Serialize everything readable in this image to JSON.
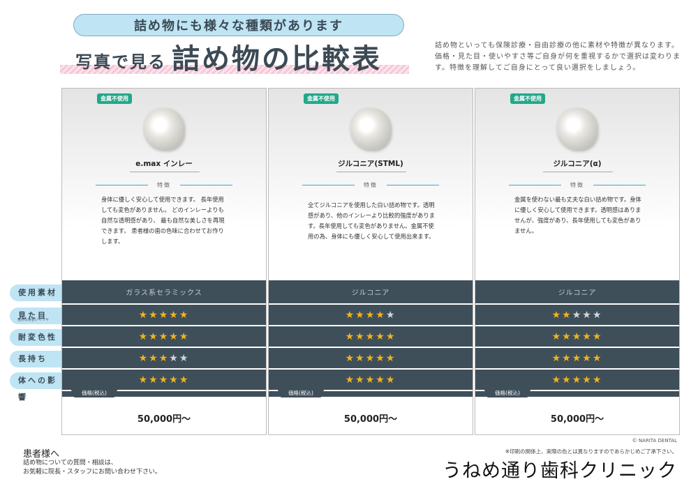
{
  "header": {
    "pill": "詰め物にも様々な種類があります",
    "title_sub": "写真で見る",
    "title_main": "詰め物の比較表",
    "intro": "詰め物といっても保険診療・自由診療の他に素材や特徴が異なります。価格・見た目・使いやすさ等ご自身が何を重視するかで選択は変わります。特徴を理解してご自身にとって良い選択をしましょう。"
  },
  "row_labels": {
    "material": "使用素材",
    "appearance": "見た目",
    "appearance_sub": "自然な色合いやツヤ",
    "discoloration": "耐変色性",
    "durability": "長持ち",
    "body_effect": "体への影響"
  },
  "feature_label": "特徴",
  "price_label": "価格(税込)",
  "colors": {
    "accent_blue": "#bfe4f4",
    "row_dark": "#3f4f5a",
    "badge_green": "#22a88a",
    "star": "#f2b41c"
  },
  "products": [
    {
      "badge": "金属不使用",
      "name": "e.max インレー",
      "desc": "身体に優しく安心して使用できます。 長年使用しても変色がありません。 どのインレーよりも自然な透明感があり、 最も自然な美しさを再現できます。 患者様の歯の色味に合わせてお作りします。",
      "material": "ガラス系セラミックス",
      "ratings": {
        "appearance": 5,
        "discoloration": 5,
        "durability": 3,
        "body_effect": 5
      },
      "price": "50,000円〜"
    },
    {
      "badge": "金属不使用",
      "name": "ジルコニア(STML)",
      "desc": "全てジルコニアを使用した白い詰め物です。透明感があり、他のインレーより比較的強度があります。長年使用しても変色がありません。金属不使用の為、身体にも優しく安心して使用出来ます。",
      "material": "ジルコニア",
      "ratings": {
        "appearance": 4,
        "discoloration": 5,
        "durability": 5,
        "body_effect": 5
      },
      "price": "50,000円〜"
    },
    {
      "badge": "金属不使用",
      "name": "ジルコニア(α)",
      "desc": "金属を使わない最も丈夫な白い詰め物です。身体に優しく安心して使用できます。透明感はありませんが、強度があり、長年使用しても変色がありません。",
      "material": "ジルコニア",
      "ratings": {
        "appearance": 2,
        "discoloration": 5,
        "durability": 5,
        "body_effect": 5
      },
      "price": "50,000円〜"
    }
  ],
  "footer": {
    "heading": "患者様へ",
    "line1": "詰め物についての質問・相談は、",
    "line2": "お気軽に院長・スタッフにお問い合わせ下さい。",
    "copyright": "© NARITA DENTAL",
    "note": "※印刷の関係上、実際の色とは異なりますのであらかじめご了承下さい。",
    "clinic": "うねめ通り歯科クリニック"
  }
}
